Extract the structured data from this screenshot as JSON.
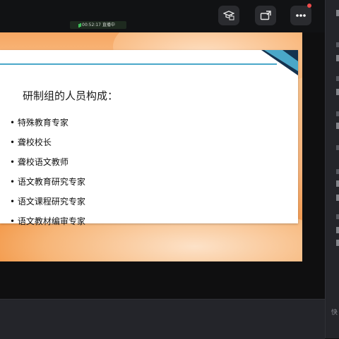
{
  "status_pill": {
    "text": "00:52:17 直播中"
  },
  "toolbar": {
    "icons": [
      "student-cap-icon",
      "screen-share-icon",
      "more-icon"
    ],
    "notification_color": "#ef4b4b"
  },
  "slide": {
    "title": "研制组的人员构成：",
    "bullets": [
      "• 特殊教育专家",
      "• 聋校校长",
      "• 聋校语文教师",
      "• 语文教育研究专家",
      "• 语文课程研究专家",
      "• 语文教材编审专家"
    ],
    "accent_color": "#4aa7c9"
  },
  "side_panel": {
    "footer_label": "快"
  }
}
